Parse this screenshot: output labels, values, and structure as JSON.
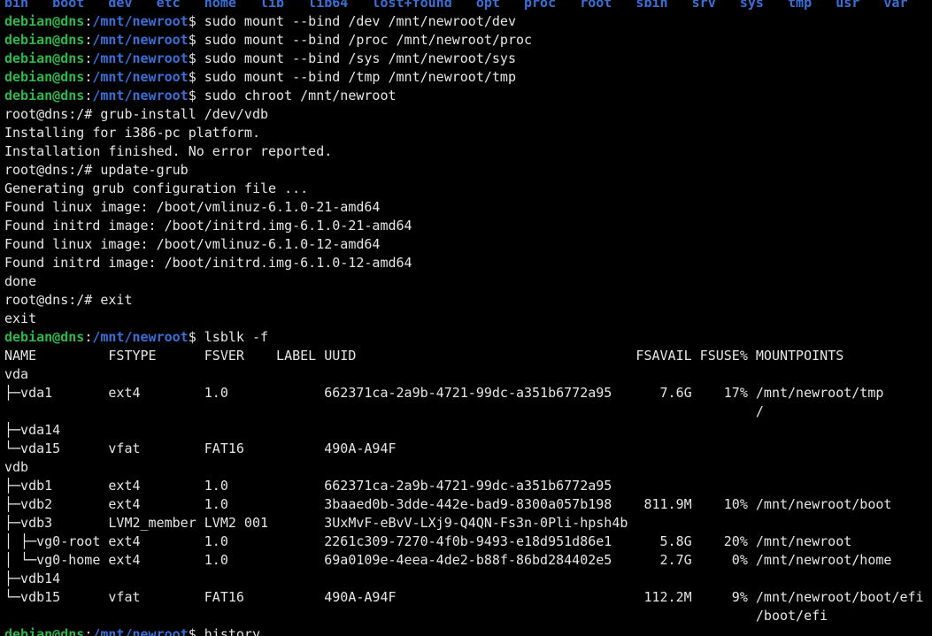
{
  "colors": {
    "background": "#000000",
    "foreground": "#e6e6e6",
    "prompt_user": "#2fb84a",
    "prompt_path": "#3a6fd8",
    "directory": "#3a6fd8"
  },
  "ls_dirs": [
    "bin",
    "boot",
    "dev",
    "etc",
    "home",
    "lib",
    "lib64",
    "lost+found",
    "opt",
    "proc",
    "root",
    "sbin",
    "srv",
    "sys",
    "tmp",
    "usr",
    "var"
  ],
  "ls_row": "bin   boot   dev   etc   home   lib   lib64   lost+found   opt   proc   root   sbin   srv   sys   tmp   usr   var",
  "prompt": {
    "user_host": "debian@dns",
    "colon": ":",
    "path": "/mnt/newroot",
    "symbol": "$"
  },
  "commands": {
    "bind_dev": "sudo mount --bind /dev /mnt/newroot/dev",
    "bind_proc": "sudo mount --bind /proc /mnt/newroot/proc",
    "bind_sys": "sudo mount --bind /sys /mnt/newroot/sys",
    "bind_tmp": "sudo mount --bind /tmp /mnt/newroot/tmp",
    "chroot": "sudo chroot /mnt/newroot",
    "lsblk": "lsblk -f",
    "history": "history"
  },
  "root_prompt": "root@dns:/#",
  "root_commands": {
    "grub_install": "grub-install /dev/vdb",
    "update_grub": "update-grub",
    "exit": "exit"
  },
  "outputs": {
    "grub_install": [
      "Installing for i386-pc platform.",
      "Installation finished. No error reported."
    ],
    "update_grub": [
      "Generating grub configuration file ...",
      "Found linux image: /boot/vmlinuz-6.1.0-21-amd64",
      "Found initrd image: /boot/initrd.img-6.1.0-21-amd64",
      "Found linux image: /boot/vmlinuz-6.1.0-12-amd64",
      "Found initrd image: /boot/initrd.img-6.1.0-12-amd64",
      "done"
    ],
    "exit": "exit"
  },
  "lsblk_output": [
    "NAME         FSTYPE      FSVER    LABEL UUID                                   FSAVAIL FSUSE% MOUNTPOINTS",
    "vda",
    "├─vda1       ext4        1.0            662371ca-2a9b-4721-99dc-a351b6772a95      7.6G    17% /mnt/newroot/tmp",
    "                                                                                              /",
    "├─vda14",
    "└─vda15      vfat        FAT16          490A-A94F",
    "vdb",
    "├─vdb1       ext4        1.0            662371ca-2a9b-4721-99dc-a351b6772a95",
    "├─vdb2       ext4        1.0            3baaed0b-3dde-442e-bad9-8300a057b198    811.9M    10% /mnt/newroot/boot",
    "├─vdb3       LVM2_member LVM2 001       3UxMvF-eBvV-LXj9-Q4QN-Fs3n-0Pli-hpsh4b",
    "│ ├─vg0-root ext4        1.0            2261c309-7270-4f0b-9493-e18d951d86e1      5.8G    20% /mnt/newroot",
    "│ └─vg0-home ext4        1.0            69a0109e-4eea-4de2-b88f-86bd284402e5      2.7G     0% /mnt/newroot/home",
    "├─vdb14",
    "└─vdb15      vfat        FAT16          490A-A94F                               112.2M     9% /mnt/newroot/boot/efi",
    "                                                                                              /boot/efi"
  ]
}
